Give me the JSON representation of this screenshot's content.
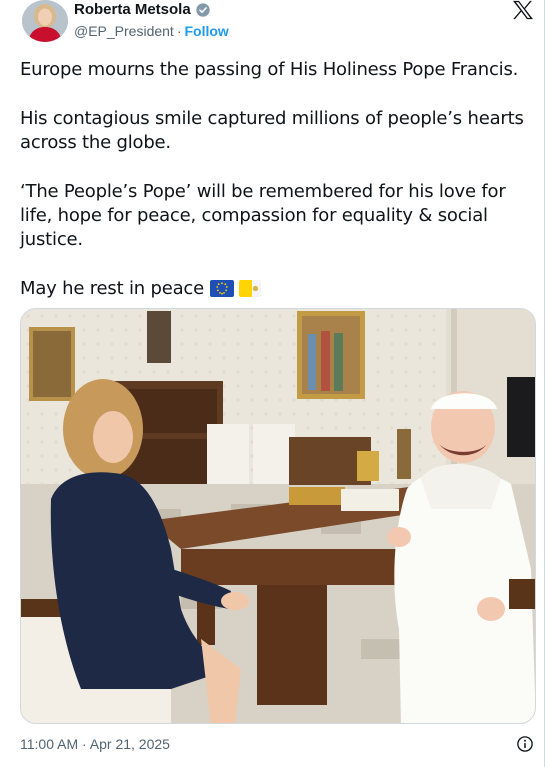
{
  "author": {
    "display_name": "Roberta Metsola",
    "handle": "@EP_President",
    "separator": "·",
    "follow_label": "Follow",
    "verified_icon": "verified-badge-icon"
  },
  "platform_icon": "x-logo-icon",
  "tweet": {
    "paragraphs": [
      "Europe mourns the passing of His Holiness Pope Francis.",
      "His contagious smile captured millions of people’s hearts across the globe.",
      "‘The People’s Pope’ will be remembered for his love for life, hope for peace, compassion for equality & social justice.",
      "May he rest in peace"
    ],
    "emoji_flags": [
      "eu-flag-icon",
      "vatican-flag-icon"
    ]
  },
  "media": {
    "type": "photo"
  },
  "footer": {
    "timestamp": "11:00 AM · Apr 21, 2025",
    "info_icon": "info-icon"
  },
  "colors": {
    "link": "#1d9bf0",
    "secondary_text": "#536471",
    "primary_text": "#0f1419"
  }
}
